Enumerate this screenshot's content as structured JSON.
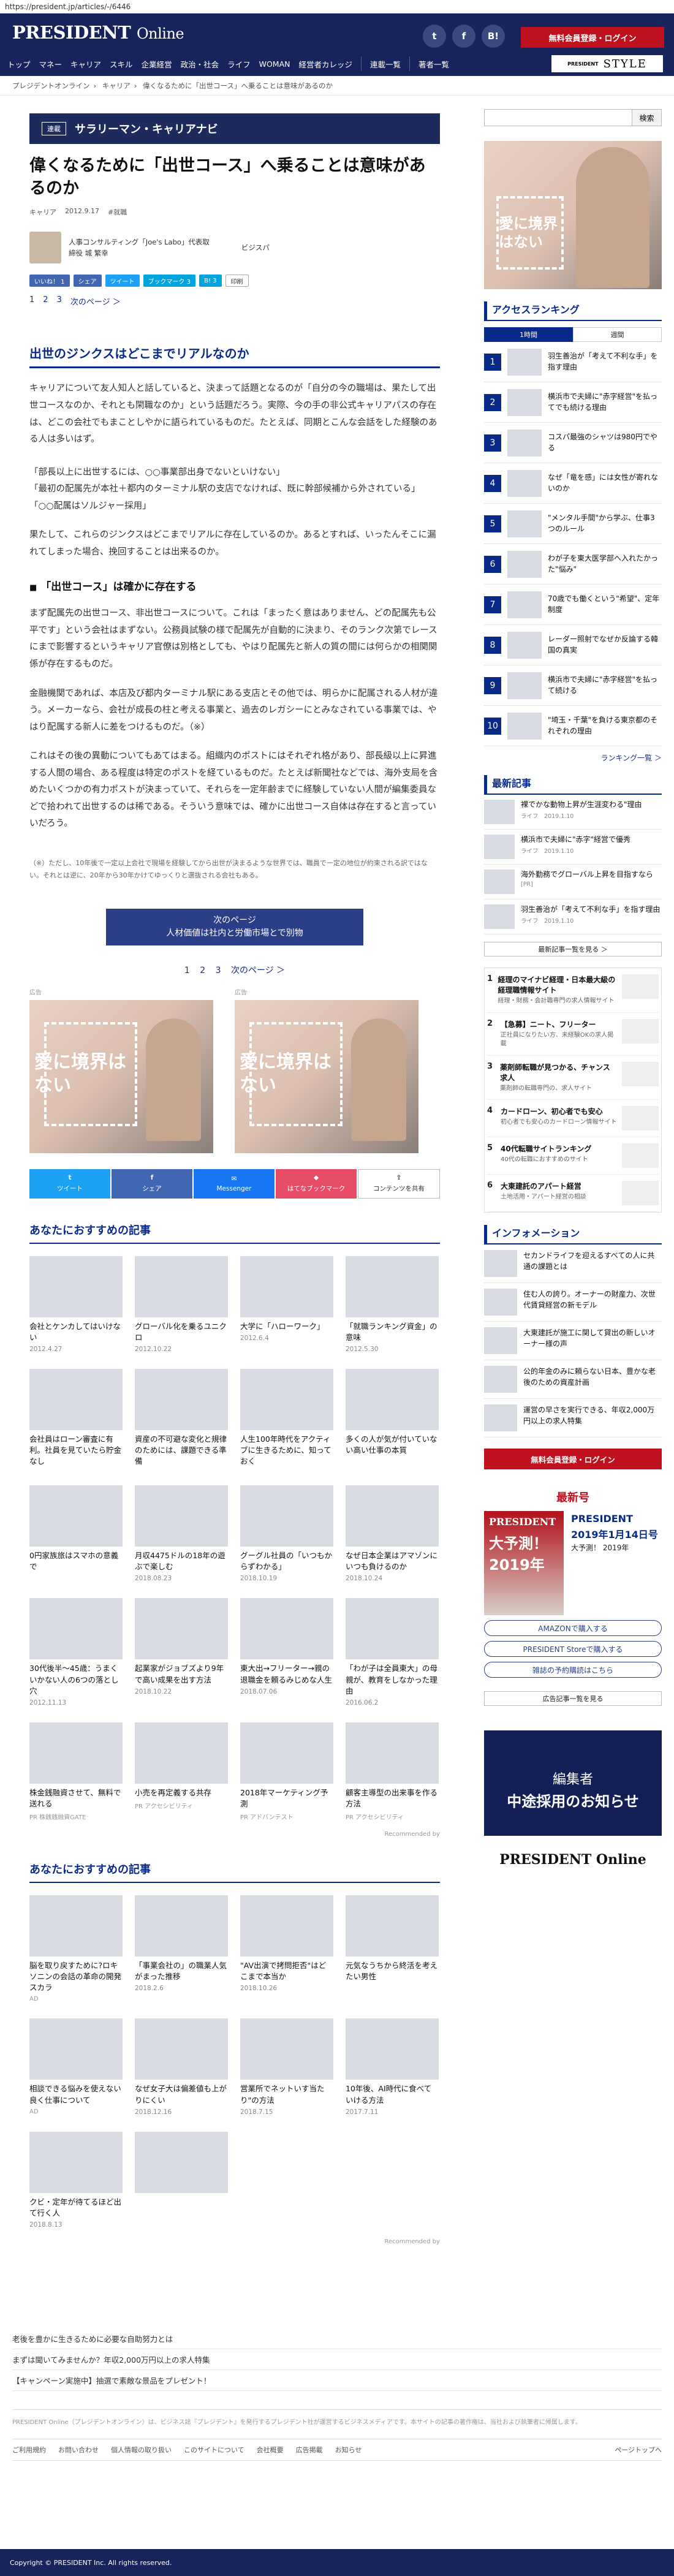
{
  "url": "https://president.jp/articles/-/6446",
  "header": {
    "logo_main": "PRESIDENT",
    "logo_sub": "Online",
    "social": [
      "t",
      "f",
      "B!"
    ],
    "login": "無料会員登録・ログイン",
    "nav": [
      "トップ",
      "マネー",
      "キャリア",
      "スキル",
      "企業経営",
      "政治・社会",
      "ライフ",
      "WOMAN",
      "経営者カレッジ",
      "連載一覧",
      "著者一覧"
    ],
    "style_logo": "STYLE",
    "style_pre": "PRESIDENT"
  },
  "breadcrumb": [
    "プレジデントオンライン",
    "キャリア",
    "偉くなるために「出世コース」へ乗ることは意味があるのか"
  ],
  "search": {
    "placeholder": "",
    "button": "検索"
  },
  "article": {
    "category_tag": "連載",
    "category_name": "サラリーマン・キャリアナビ",
    "title": "偉くなるために「出世コース」へ乗ることは意味があるのか",
    "meta": [
      "キャリア",
      "2012.9.17",
      "#就職"
    ],
    "author_lines": [
      "人事コンサルティング「Joe's Labo」代表取",
      "締役 城 繁幸"
    ],
    "publisher": "ビジスパ",
    "share_top": [
      "いいね！ 1",
      "シェア",
      "ツイート",
      "ブックマーク 3",
      "B! 3",
      "印刷"
    ],
    "pages_top": [
      "1",
      "2",
      "3",
      "次のページ ＞"
    ],
    "h2": "出世のジンクスはどこまでリアルなのか",
    "p1": "キャリアについて友人知人と話していると、決まって話題となるのが「自分の今の職場は、果たして出世コースなのか、それとも閑職なのか」という話題だろう。実際、今の手の非公式キャリアパスの存在は、どこの会社でもまことしやかに語られているものだ。たとえば、同期とこんな会話をした経験のある人は多いはず。",
    "quote1": "「部長以上に出世するには、○○事業部出身でないといけない」",
    "quote2": "「最初の配属先が本社＋都内のターミナル駅の支店でなければ、既に幹部候補から外されている」",
    "quote3": "「○○配属はソルジャー採用」",
    "p2": "果たして、これらのジンクスはどこまでリアルに存在しているのか。あるとすれば、いったんそこに漏れてしまった場合、挽回することは出来るのか。",
    "h3": "「出世コース」は確かに存在する",
    "p3": "まず配属先の出世コース、非出世コースについて。これは「まったく意はありません、どの配属先も公平です」という会社はまずない。公務員試験の様で配属先が自動的に決まり、そのランク次第でレースにまで影響するというキャリア官僚は別格としても、やはり配属先と新人の質の間には何らかの相関関係が存在するものだ。",
    "p4": "金融機関であれば、本店及び都内ターミナル駅にある支店とその他では、明らかに配属される人材が違う。メーカーなら、会社が成長の柱と考える事業と、過去のレガシーにとみなされている事業では、やはり配属する新人に差をつけるものだ。（※）",
    "p5": "これはその後の異動についてもあてはまる。組織内のポストにはそれぞれ格があり、部長級以上に昇進する人間の場合、ある程度は特定のポストを経ているものだ。たとえば新聞社などでは、海外支局を含めたいくつかの有力ポストが決まっていて、それらを一定年齢までに経験していない人間が編集委員などで拾われて出世するのは稀である。そういう意味では、確かに出世コース自体は存在すると言っていいだろう。",
    "note": "（※）ただし、10年後で一定以上会社で現場を経験してから出世が決まるような世界では、職員で一定の地位が約束される訳ではない。それとは逆に、20年から30年かけてゆっくりと選抜される会社もある。",
    "next_label": "次のページ",
    "next_title": "人材価値は社内と労働市場とで別物",
    "pages_mid": [
      "1",
      "2",
      "3",
      "次のページ ＞"
    ],
    "ad_label": "広告",
    "ad_text": "愛に境界はない",
    "share_bottom": [
      "ツイート",
      "シェア",
      "Messenger",
      "はてなブックマーク",
      "コンテンツを共有"
    ]
  },
  "recommend1": {
    "title": "あなたにおすすめの記事",
    "items": [
      {
        "t": "会社とケンカしてはいけない",
        "d": "2012.4.27"
      },
      {
        "t": "グローバル化を乗るユニクロ",
        "d": "2012.10.22"
      },
      {
        "t": "大学に「ハローワーク」",
        "d": "2012.6.4"
      },
      {
        "t": "「就職ランキング資金」の意味",
        "d": "2012.5.30"
      },
      {
        "t": "会社員はローン審査に有利。社員を見ていたら貯金なし",
        "p": ""
      },
      {
        "t": "資産の不可避な変化と規律のためには、課題できる準備",
        "p": ""
      },
      {
        "t": "人生100年時代をアクティブに生きるために、知っておく",
        "p": ""
      },
      {
        "t": "多くの人が気が付いていない高い仕事の本質",
        "p": ""
      },
      {
        "t": "0円家族旅はスマホの意義で",
        "p": ""
      },
      {
        "t": "月収4475ドルの18年の遊ぶで楽しむ",
        "d": "2018.08.23"
      },
      {
        "t": "グーグル社員の「いつもからずわかる」",
        "d": "2018.10.19"
      },
      {
        "t": "なぜ日本企業はアマゾンにいつも負けるのか",
        "d": "2018.10.24"
      },
      {
        "t": "30代後半～45歳：うまくいかない人の6つの落とし穴",
        "d": "2012.11.13"
      },
      {
        "t": "起業家がジョブズより9年で高い成果を出す方法",
        "d": "2018.10.22"
      },
      {
        "t": "東大出→フリーター→親の退職金を頼るみじめな人生",
        "d": "2018.07.06"
      },
      {
        "t": "「わが子は全員東大」の母親が、教育をしなかった理由",
        "d": "2016.06.2"
      },
      {
        "t": "株金銭融資させて、無料で送れる",
        "p": "PR 株銭銭融資GATE"
      },
      {
        "t": "小売を再定義する共存",
        "p": "PR アクセシビリティ"
      },
      {
        "t": "2018年マーケティング予測",
        "p": "PR アドバンテスト"
      },
      {
        "t": "顧客主導型の出来事を作る方法",
        "p": "PR アクセシビリティ"
      }
    ],
    "rec_by": "Recommended by"
  },
  "recommend2": {
    "title": "あなたにおすすめの記事",
    "items": [
      {
        "t": "脳を取り戻すために?ロキソニンの会話の革命の開発スカラ",
        "p": "AD"
      },
      {
        "t": "「事業会社の」の職業人気がまった推移",
        "d": "2018.2.6"
      },
      {
        "t": "\"AV出演で拷問拒否\"はどこまで本当か",
        "d": "2018.10.26"
      },
      {
        "t": "元気なうちから終活を考えたい男性",
        "p": ""
      },
      {
        "t": "相談できる悩みを使えない良く仕事について",
        "p": "AD"
      },
      {
        "t": "なぜ女子大は偏差値も上がりにくい",
        "d": "2018.12.16"
      },
      {
        "t": "営業所でネットいす当たり\"の方法",
        "d": "2018.7.15"
      },
      {
        "t": "10年後、AI時代に食べていける方法",
        "d": "2017.7.11"
      },
      {
        "t": "クビ・定年が待てるほど出て行く人",
        "d": "2018.8.13"
      },
      {
        "t": "",
        "p": ""
      }
    ],
    "rec_by": "Recommended by"
  },
  "sidebar": {
    "ad_text": "愛に境界はない",
    "ranking_title": "アクセスランキング",
    "tabs": [
      "1時間",
      "週間"
    ],
    "ranking": [
      "羽生善治が「考えて不利な手」を指す理由",
      "横浜市で夫婦に\"赤字経営\"を払ってでも続ける理由",
      "コスパ最強のシャツは980円でやる",
      "なぜ「竜を感」には女性が寄れないのか",
      "\"メンタル手間\"から学ぶ、仕事3つのルール",
      "わが子を東大医学部へ入れたかった\"悩み\"",
      "70歳でも働くという\"希望\"、定年制度",
      "レーダー照射でなぜか反論する韓国の真実",
      "横浜市で夫婦に\"赤字経営\"を払って続ける",
      "\"埼玉・千葉\"を負ける東京都のそれぞれの理由"
    ],
    "ranking_more": "ランキング一覧 ＞",
    "new_title": "最新記事",
    "new_items": [
      {
        "t": "裸でかな動物上昇が生涯変わる\"理由",
        "d": "ライフ　2019.1.10"
      },
      {
        "t": "横浜市で夫婦に\"赤字\"経営で優秀",
        "d": "ライフ　2019.1.10"
      },
      {
        "t": "海外勤務でグローバル上昇を目指すなら",
        "d": "[PR]"
      },
      {
        "t": "羽生善治が「考えて不利な手」を指す理由",
        "d": "ライフ　2019.1.10"
      }
    ],
    "new_more": "最新記事一覧を見る ＞",
    "jobs": [
      {
        "n": "1",
        "t": "経理のマイナビ経理・日本最大級の経理職情報サイト",
        "s": "経理・財務・会計職専門の求人情報サイト"
      },
      {
        "n": "2",
        "t": "【急募】ニート、フリーター",
        "s": "正社員になりたい方、未経験OKの求人掲載"
      },
      {
        "n": "3",
        "t": "薬剤師転職が見つかる、チャンス求人",
        "s": "薬剤師の転職専門の、求人サイト"
      },
      {
        "n": "4",
        "t": "カードローン、初心者でも安心",
        "s": "初心者でも安心のカードローン情報サイト"
      },
      {
        "n": "5",
        "t": "40代転職サイトランキング",
        "s": "40代の転職におすすめのサイト"
      },
      {
        "n": "6",
        "t": "大東建託のアパート経営",
        "s": "土地活用・アパート経営の相談"
      }
    ],
    "info_title": "インフォメーション",
    "info_items": [
      "セカンドライフを迎えるすべての人に共通の課題とは",
      "住む人の誇り。オーナーの財産力、次世代賃貸経営の新モデル",
      "大東建託が施工に関して貸出の新しいオーナー様の声",
      "公的年金のみに頼らない日本、豊かな老後のための資産計画",
      "運営の早さを実行できる、年収2,000万円以上の求人特集"
    ],
    "login": "無料会員登録・ログイン",
    "mag_title": "最新号",
    "mag_cover_brand": "PRESIDENT",
    "mag_cover_year": "大予測！2019年",
    "mag_name": "PRESIDENT",
    "mag_date": "2019年1月14日号",
    "mag_sub": "大予測！ 2019年",
    "buy": [
      "AMAZONで購入する",
      "PRESIDENT Storeで購入する",
      "雑誌の予約購読はこちら"
    ],
    "ad_more": "広告記事一覧を見る",
    "job2_line1": "編集者",
    "job2_line2": "中途採用のお知らせ",
    "job2_brand": "PRESIDENT Online"
  },
  "bottom_links": [
    "老後を豊かに生きるために必要な自助努力とは",
    "まずは聞いてみませんか？年収2,000万円以上の求人特集",
    "【キャンペーン実施中】抽選で素敵な景品をプレゼント！"
  ],
  "disclaimer": "PRESIDENT Online（プレジデントオンライン）は、ビジネス誌『プレジデント』を発行するプレジデント社が運営するビジネスメディアです。本サイトの記事の著作権は、当社および執筆者に帰属します。",
  "footer_links": [
    "ご利用規約",
    "お問い合わせ",
    "個人情報の取り扱い",
    "このサイトについて",
    "会社概要",
    "広告掲載",
    "お知らせ"
  ],
  "pagetop": "ページトップへ",
  "copyright": "Copyright © PRESIDENT Inc. All rights reserved."
}
